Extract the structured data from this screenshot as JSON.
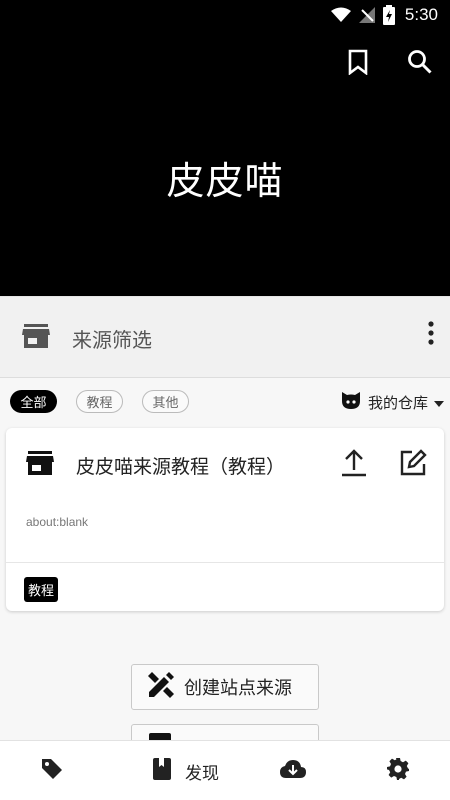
{
  "status_bar": {
    "time": "5:30"
  },
  "header": {
    "title": "皮皮喵"
  },
  "filter": {
    "label": "来源筛选"
  },
  "chips": [
    {
      "label": "全部",
      "selected": true
    },
    {
      "label": "教程",
      "selected": false
    },
    {
      "label": "其他",
      "selected": false
    }
  ],
  "repo": {
    "label": "我的仓库"
  },
  "card": {
    "title": "皮皮喵来源教程（教程）",
    "url": "about:blank",
    "tag": "教程"
  },
  "buttons": {
    "create": "创建站点来源"
  },
  "bottom_nav": {
    "discover_label": "发现"
  },
  "colors": {
    "header_bg": "#000000",
    "accent": "#000000",
    "page_bg": "#f7f7f7"
  }
}
